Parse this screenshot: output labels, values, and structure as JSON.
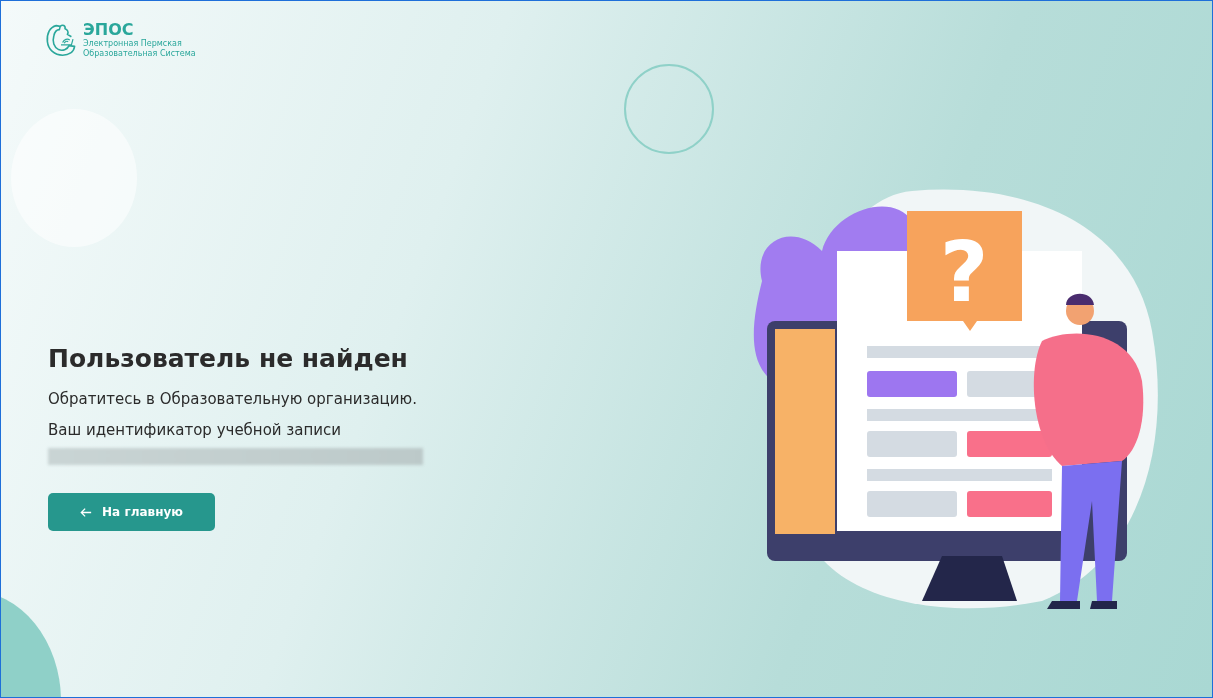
{
  "logo": {
    "name": "ЭПОС",
    "subtitle_line_1": "Электронная Пермская",
    "subtitle_line_2": "Образовательная Система"
  },
  "message": {
    "title": "Пользователь не найден",
    "text": "Обратитесь в Образовательную организацию.",
    "id_label": "Ваш идентификатор учебной записи"
  },
  "button": {
    "label": "На главную"
  },
  "illustration": {
    "badge_symbol": "?"
  }
}
